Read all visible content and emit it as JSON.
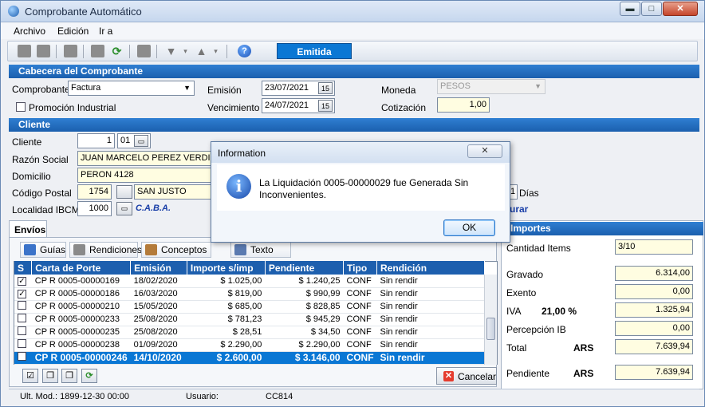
{
  "window": {
    "title": "Comprobante Automático",
    "min": "▬",
    "max": "□",
    "close": "✕"
  },
  "menu": {
    "archivo": "Archivo",
    "edicion": "Edición",
    "ira": "Ir a"
  },
  "toolbar": {
    "status": "Emitida",
    "help": "?"
  },
  "cabecera": {
    "section": "Cabecera del Comprobante",
    "comprobante_label": "Comprobante",
    "comprobante_value": "Factura",
    "emision_label": "Emisión",
    "emision_value": "23/07/2021",
    "vencimiento_label": "Vencimiento",
    "vencimiento_value": "24/07/2021",
    "moneda_label": "Moneda",
    "moneda_value": "PESOS",
    "cotizacion_label": "Cotización",
    "cotizacion_value": "1,00",
    "promocion_label": "Promoción Industrial"
  },
  "cliente": {
    "section": "Cliente",
    "cliente_label": "Cliente",
    "cliente_value": "1",
    "cliente_suc": "01",
    "razon_label": "Razón Social",
    "razon_value": "JUAN MARCELO PEREZ VERDI",
    "domicilio_label": "Domicilio",
    "domicilio_value": "PERON 4128",
    "cp_label": "Código Postal",
    "cp_value": "1754",
    "cp_localidad": "SAN JUSTO",
    "ibcm_label": "Localidad IBCM",
    "ibcm_value": "1000",
    "ibcm_text": "C.A.B.A.",
    "dias_label": "Días",
    "dias_value": "1",
    "link_text": "urar"
  },
  "envios": {
    "tab": "Envíos",
    "subtabs": {
      "guias": "Guías",
      "rendiciones": "Rendiciones",
      "conceptos": "Conceptos",
      "texto": "Texto"
    },
    "columns": [
      "S",
      "Carta de Porte",
      "Emisión",
      "Importe s/imp",
      "Pendiente",
      "Tipo",
      "Rendición"
    ],
    "rows": [
      {
        "check": "✓",
        "carta": "CP R 0005-00000169",
        "emision": "18/02/2020",
        "importe": "$ 1.025,00",
        "pendiente": "$ 1.240,25",
        "tipo": "CONF",
        "rendicion": "Sin rendir"
      },
      {
        "check": "✓",
        "carta": "CP R 0005-00000186",
        "emision": "16/03/2020",
        "importe": "$ 819,00",
        "pendiente": "$ 990,99",
        "tipo": "CONF",
        "rendicion": "Sin rendir"
      },
      {
        "check": "",
        "carta": "CP R 0005-00000210",
        "emision": "15/05/2020",
        "importe": "$ 685,00",
        "pendiente": "$ 828,85",
        "tipo": "CONF",
        "rendicion": "Sin rendir"
      },
      {
        "check": "",
        "carta": "CP R 0005-00000233",
        "emision": "25/08/2020",
        "importe": "$ 781,23",
        "pendiente": "$ 945,29",
        "tipo": "CONF",
        "rendicion": "Sin rendir"
      },
      {
        "check": "",
        "carta": "CP R 0005-00000235",
        "emision": "25/08/2020",
        "importe": "$ 28,51",
        "pendiente": "$ 34,50",
        "tipo": "CONF",
        "rendicion": "Sin rendir"
      },
      {
        "check": "",
        "carta": "CP R 0005-00000238",
        "emision": "01/09/2020",
        "importe": "$ 2.290,00",
        "pendiente": "$ 2.290,00",
        "tipo": "CONF",
        "rendicion": "Sin rendir"
      },
      {
        "check": "",
        "carta": "CP R 0005-00000246",
        "emision": "14/10/2020",
        "importe": "$ 2.600,00",
        "pendiente": "$ 3.146,00",
        "tipo": "CONF",
        "rendicion": "Sin rendir"
      }
    ],
    "cancel": "Cancelar"
  },
  "importes": {
    "section": "Importes",
    "cantidad_label": "Cantidad Items",
    "cantidad_value": "3/10",
    "gravado_label": "Gravado",
    "gravado_value": "6.314,00",
    "exento_label": "Exento",
    "exento_value": "0,00",
    "iva_label": "IVA",
    "iva_pct": "21,00 %",
    "iva_value": "1.325,94",
    "percepcion_label": "Percepción IB",
    "percepcion_value": "0,00",
    "total_label": "Total",
    "total_cur": "ARS",
    "total_value": "7.639,94",
    "pendiente_label": "Pendiente",
    "pendiente_cur": "ARS",
    "pendiente_value": "7.639,94"
  },
  "statusbar": {
    "ult_mod": "Ult. Mod.: 1899-12-30 00:00",
    "usuario_label": "Usuario:",
    "code": "CC814"
  },
  "dialog": {
    "title": "Information",
    "message": "La Liquidación 0005-00000029 fue Generada Sin Inconvenientes.",
    "ok": "OK",
    "close": "✕",
    "icon": "i"
  }
}
